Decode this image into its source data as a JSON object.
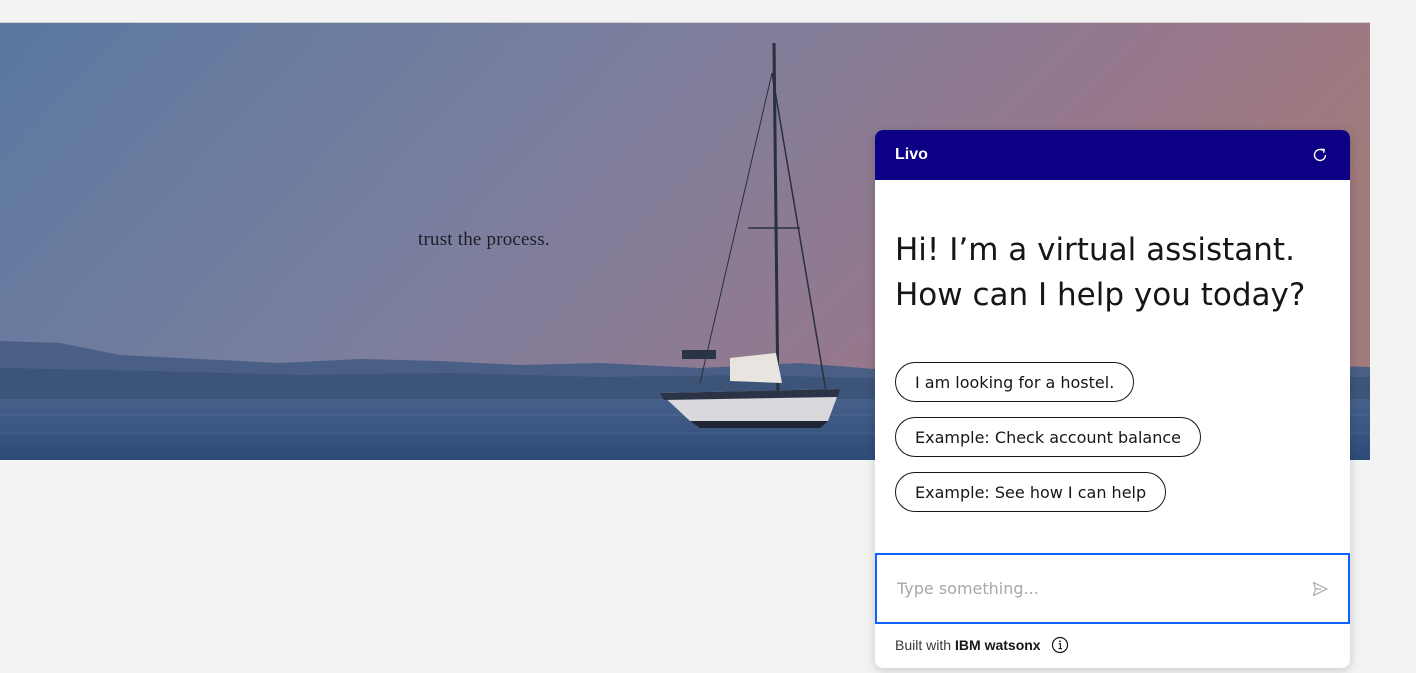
{
  "hero": {
    "tagline": "trust the process."
  },
  "chat": {
    "title": "Livo",
    "header_color": "#0e0085",
    "restart_icon": "restart-icon",
    "greeting_line1": "Hi! I’m a virtual assistant.",
    "greeting_line2": "How can I help you today?",
    "suggestions": [
      "I am looking for a hostel.",
      "Example: Check account balance",
      "Example: See how I can help"
    ],
    "input_placeholder": "Type something...",
    "input_value": "",
    "input_border_color": "#0f62fe",
    "send_icon": "send-icon",
    "footer_prefix": "Built with",
    "footer_brand": "IBM watsonx",
    "info_icon": "info-icon"
  }
}
